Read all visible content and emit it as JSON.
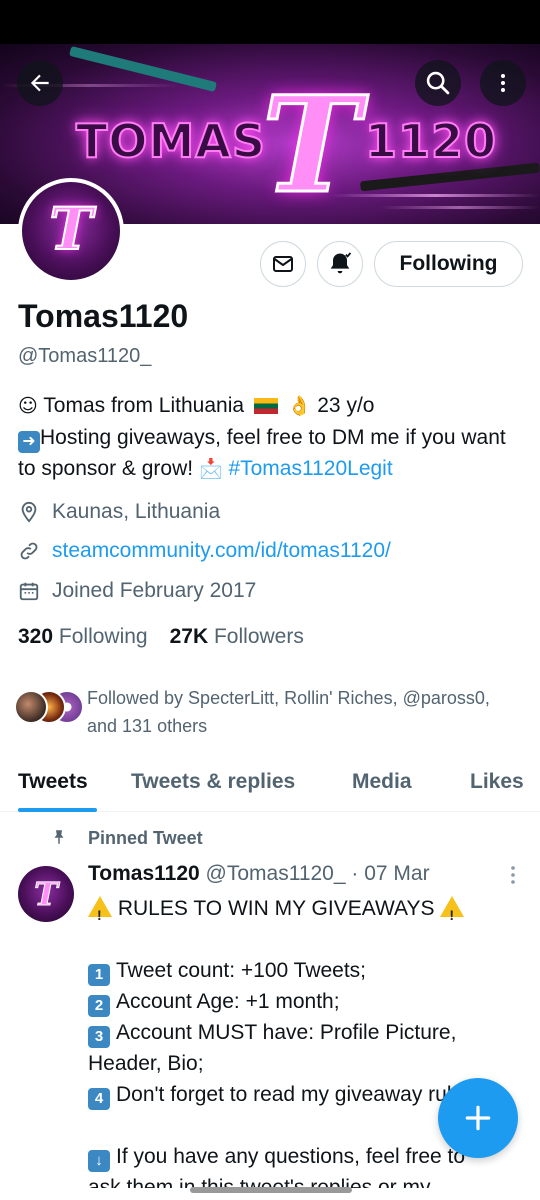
{
  "header": {
    "banner_text_left": "TOMAS",
    "banner_letter": "T",
    "banner_text_right": "1120",
    "back_icon": "back-arrow-icon",
    "search_icon": "search-icon",
    "more_icon": "more-vertical-icon"
  },
  "profile": {
    "avatar_letter": "T",
    "display_name": "Tomas1120",
    "handle": "@Tomas1120_",
    "bio_line1": "Tomas from Lithuania",
    "bio_age": "23 y/o",
    "bio_line2": "Hosting giveaways, feel free to DM me if you want to sponsor & grow!",
    "bio_hashtag": "#Tomas1120Legit",
    "location": "Kaunas, Lithuania",
    "website": "steamcommunity.com/id/tomas1120/",
    "joined": "Joined February 2017",
    "following_count": "320",
    "following_label": "Following",
    "followers_count": "27K",
    "followers_label": "Followers",
    "followed_by": "Followed by SpecterLitt, Rollin' Riches, @paross0, and 131 others"
  },
  "actions": {
    "following_button": "Following"
  },
  "tabs": [
    {
      "label": "Tweets",
      "active": true
    },
    {
      "label": "Tweets & replies",
      "active": false
    },
    {
      "label": "Media",
      "active": false
    },
    {
      "label": "Likes",
      "active": false
    }
  ],
  "tweet": {
    "pinned_label": "Pinned Tweet",
    "author": "Tomas1120",
    "handle": "@Tomas1120_",
    "date": "· 07 Mar",
    "title": "RULES TO WIN MY GIVEAWAYS",
    "rule1": "Tweet count: +100 Tweets;",
    "rule2": "Account Age: +1 month;",
    "rule3a": "Account MUST have: Profile Picture,",
    "rule3b": "Header, Bio;",
    "rule4": "Don't forget to read my giveaway rules.",
    "note1": "If you have any questions, feel free to",
    "note2": "ask them in this tweet's replies or my"
  },
  "colors": {
    "accent": "#1d9bf0",
    "text_primary": "#0f1419",
    "text_secondary": "#536471",
    "banner_purple": "#6a1a7e"
  }
}
